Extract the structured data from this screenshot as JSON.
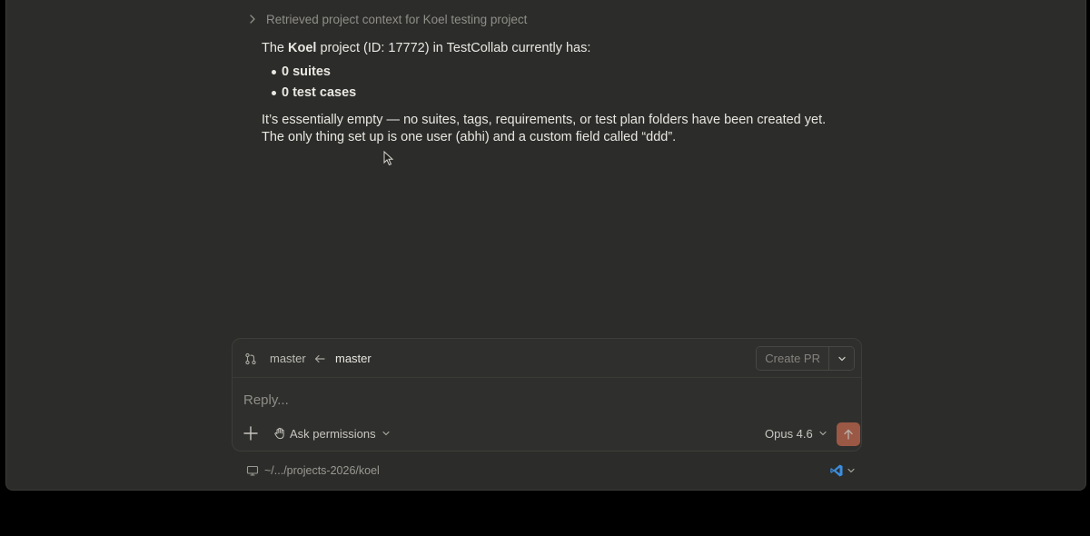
{
  "transcript": {
    "tool_call_label": "Retrieved project context for Koel testing project",
    "message": {
      "intro_prefix": "The ",
      "project_name": "Koel",
      "intro_suffix": " project (ID: 17772) in TestCollab currently has:",
      "bullets": [
        "0 suites",
        "0 test cases"
      ],
      "conclusion": "It’s essentially empty — no suites, tags, requirements, or test plan folders have been created yet. The only thing set up is one user (abhi) and a custom field called “ddd”."
    }
  },
  "composer": {
    "branch_from": "master",
    "branch_to": "master",
    "create_pr_label": "Create PR",
    "reply_placeholder": "Reply...",
    "permission_mode": "Ask permissions",
    "model": "Opus 4.6"
  },
  "footer": {
    "path": "~/.../projects-2026/koel"
  },
  "colors": {
    "window_bg": "#2c2c2a",
    "send_accent": "#c96a4e",
    "vscode_blue": "#3b8ee0"
  }
}
